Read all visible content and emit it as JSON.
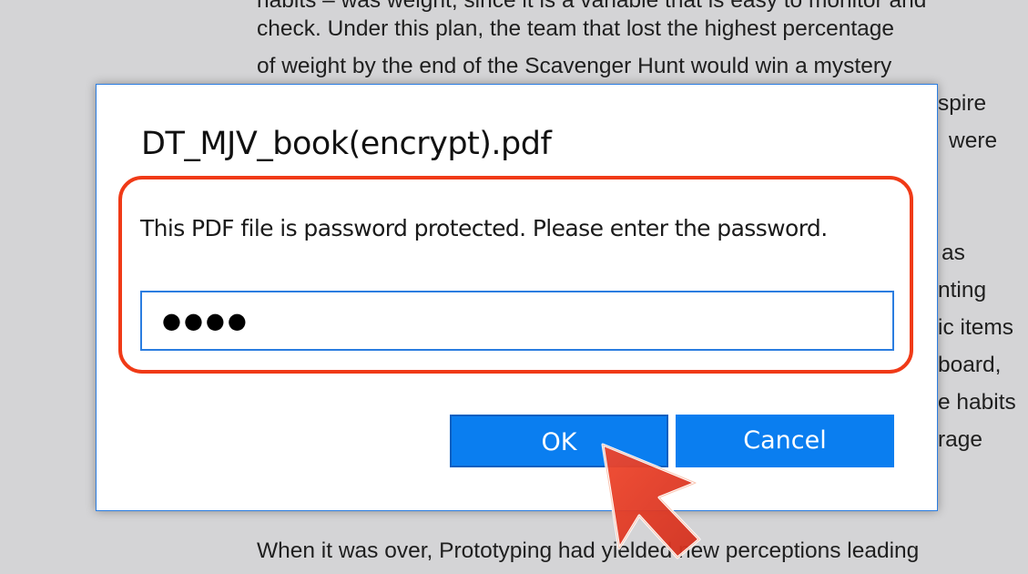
{
  "document": {
    "lines": [
      "habits – was weight, since it is a variable that is easy to monitor and",
      "check. Under this plan, the team that lost the highest percentage",
      "of weight by the end of the Scavenger Hunt would win a mystery",
      "When it was over, Prototyping had yielded new perceptions leading"
    ],
    "right_fragments": [
      "spire",
      "were",
      "as",
      "nting",
      "ic items",
      "board,",
      "e habits",
      "rage"
    ]
  },
  "dialog": {
    "title": "DT_MJV_book(encrypt).pdf",
    "message": "This PDF file is password protected. Please enter the password.",
    "password_value": "●●●●",
    "ok_label": "OK",
    "cancel_label": "Cancel"
  },
  "colors": {
    "accent": "#0a7ef0",
    "highlight": "#f03a17",
    "cursor": "#e2402a"
  },
  "icons": {
    "cursor": "pointer-arrow-icon"
  }
}
